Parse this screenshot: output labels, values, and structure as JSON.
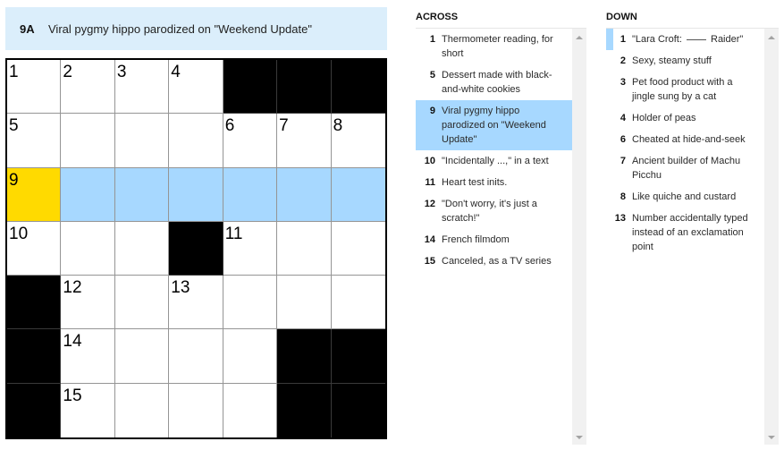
{
  "current_clue": {
    "label": "9A",
    "text": "Viral pygmy hippo parodized on \"Weekend Update\""
  },
  "colors": {
    "selected_cell": "#ffda00",
    "highlighted_word": "#a7d8ff",
    "clue_bar": "#dbeefb",
    "block": "#000000"
  },
  "grid": {
    "rows": 7,
    "cols": 7,
    "cells": [
      [
        {
          "n": "1"
        },
        {
          "n": "2"
        },
        {
          "n": "3"
        },
        {
          "n": "4"
        },
        {
          "b": true
        },
        {
          "b": true
        },
        {
          "b": true
        }
      ],
      [
        {
          "n": "5"
        },
        {},
        {},
        {},
        {
          "n": "6"
        },
        {
          "n": "7"
        },
        {
          "n": "8"
        }
      ],
      [
        {
          "n": "9",
          "sel": true
        },
        {
          "hl": true
        },
        {
          "hl": true
        },
        {
          "hl": true
        },
        {
          "hl": true
        },
        {
          "hl": true
        },
        {
          "hl": true
        }
      ],
      [
        {
          "n": "10"
        },
        {},
        {},
        {
          "b": true
        },
        {
          "n": "11"
        },
        {},
        {}
      ],
      [
        {
          "b": true
        },
        {
          "n": "12"
        },
        {},
        {
          "n": "13"
        },
        {},
        {},
        {}
      ],
      [
        {
          "b": true
        },
        {
          "n": "14"
        },
        {},
        {},
        {},
        {
          "b": true
        },
        {
          "b": true
        }
      ],
      [
        {
          "b": true
        },
        {
          "n": "15"
        },
        {},
        {},
        {},
        {
          "b": true
        },
        {
          "b": true
        }
      ]
    ]
  },
  "across": {
    "heading": "ACROSS",
    "clues": [
      {
        "num": "1",
        "text": "Thermometer reading, for short"
      },
      {
        "num": "5",
        "text": "Dessert made with black-and-white cookies"
      },
      {
        "num": "9",
        "text": "Viral pygmy hippo parodized on \"Weekend Update\"",
        "active": true
      },
      {
        "num": "10",
        "text": "\"Incidentally ...,\" in a text"
      },
      {
        "num": "11",
        "text": "Heart test inits."
      },
      {
        "num": "12",
        "text": "\"Don't worry, it's just a scratch!\""
      },
      {
        "num": "14",
        "text": "French filmdom"
      },
      {
        "num": "15",
        "text": "Canceled, as a TV series"
      }
    ]
  },
  "down": {
    "heading": "DOWN",
    "clues": [
      {
        "num": "1",
        "text_before": "\"Lara Croft: ",
        "text_after": " Raider\"",
        "cross": true
      },
      {
        "num": "2",
        "text": "Sexy, steamy stuff"
      },
      {
        "num": "3",
        "text": "Pet food product with a jingle sung by a cat"
      },
      {
        "num": "4",
        "text": "Holder of peas"
      },
      {
        "num": "6",
        "text": "Cheated at hide-and-seek"
      },
      {
        "num": "7",
        "text": "Ancient builder of Machu Picchu"
      },
      {
        "num": "8",
        "text": "Like quiche and custard"
      },
      {
        "num": "13",
        "text": "Number accidentally typed instead of an exclamation point"
      }
    ]
  }
}
